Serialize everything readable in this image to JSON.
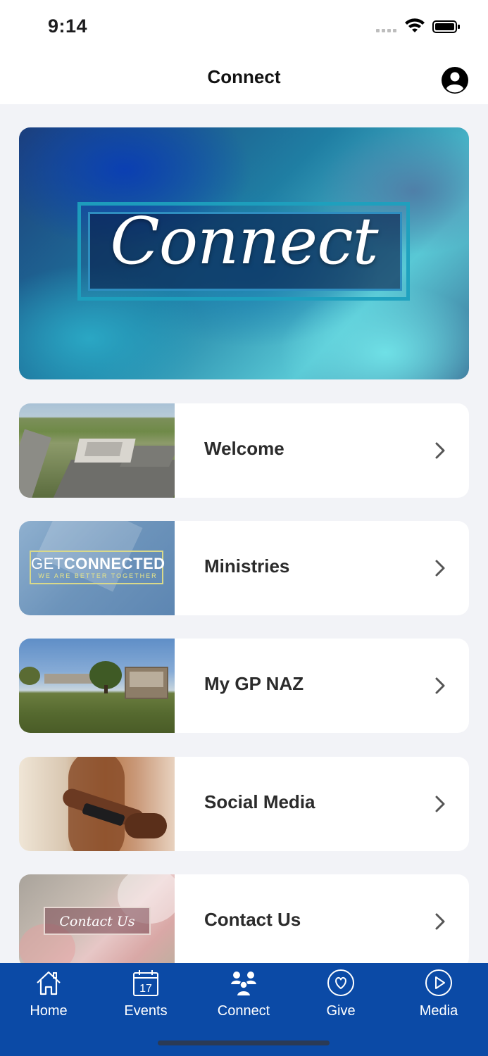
{
  "status_bar": {
    "time": "9:14"
  },
  "nav": {
    "title": "Connect",
    "profile_icon": "person-circle-icon"
  },
  "hero": {
    "title": "Connect"
  },
  "items": [
    {
      "label": "Welcome",
      "icon": "chevron-right-icon"
    },
    {
      "label": "Ministries",
      "icon": "chevron-right-icon",
      "thumb_text_1a": "GET",
      "thumb_text_1b": "CONNECTED",
      "thumb_text_2": "WE ARE BETTER TOGETHER"
    },
    {
      "label": "My GP NAZ",
      "icon": "chevron-right-icon"
    },
    {
      "label": "Social Media",
      "icon": "chevron-right-icon"
    },
    {
      "label": "Contact Us",
      "icon": "chevron-right-icon",
      "thumb_text": "Contact Us"
    }
  ],
  "tabs": [
    {
      "label": "Home",
      "icon": "home-icon"
    },
    {
      "label": "Events",
      "icon": "calendar-icon",
      "icon_text": "17"
    },
    {
      "label": "Connect",
      "icon": "people-icon"
    },
    {
      "label": "Give",
      "icon": "heart-circle-icon"
    },
    {
      "label": "Media",
      "icon": "play-circle-icon"
    }
  ],
  "colors": {
    "tab_bar": "#0b4aa6",
    "background": "#f2f3f7",
    "card": "#ffffff"
  }
}
